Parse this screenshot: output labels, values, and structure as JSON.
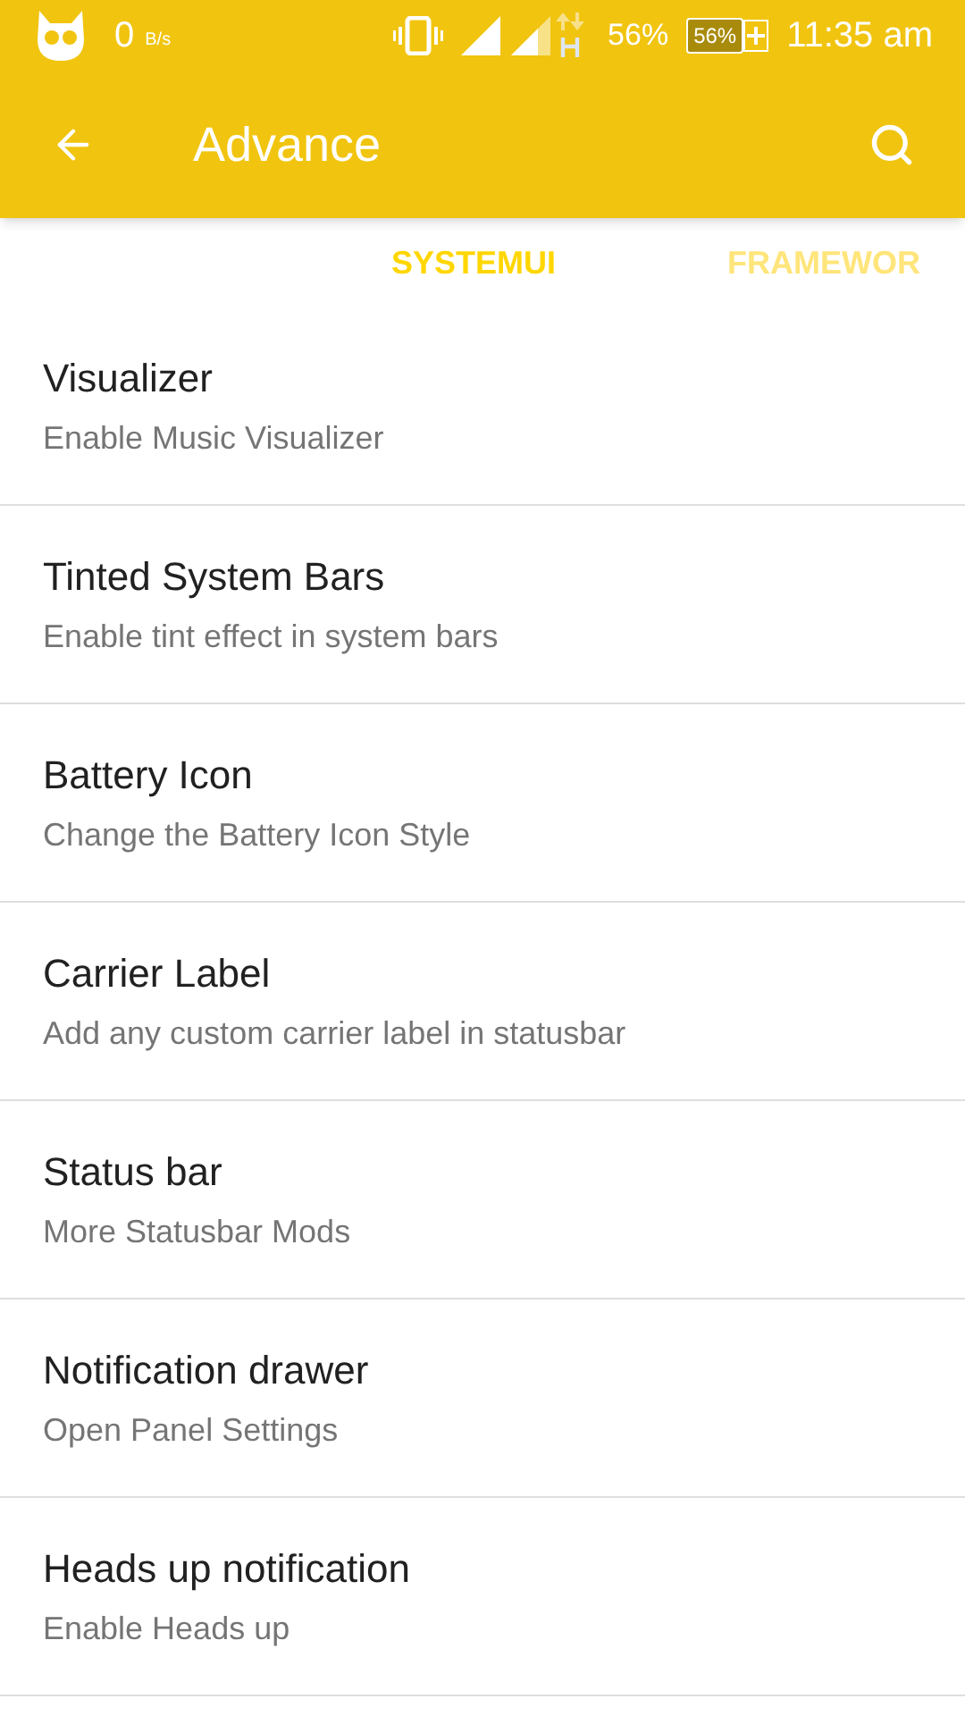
{
  "status_bar": {
    "speed": "0",
    "speed_unit": "B/s",
    "battery_percent": "56%",
    "battery_level": "56%",
    "time": "11:35 am"
  },
  "toolbar": {
    "title": "Advance"
  },
  "tabs": [
    {
      "label": "SYSTEMUI",
      "selected": true
    },
    {
      "label": "FRAMEWOR",
      "selected": false
    }
  ],
  "items": [
    {
      "title": "Visualizer",
      "subtitle": "Enable Music Visualizer"
    },
    {
      "title": "Tinted System Bars",
      "subtitle": "Enable tint effect in system bars"
    },
    {
      "title": "Battery Icon",
      "subtitle": "Change the Battery Icon Style"
    },
    {
      "title": "Carrier Label",
      "subtitle": "Add any custom carrier label in statusbar"
    },
    {
      "title": "Status bar",
      "subtitle": "More Statusbar Mods"
    },
    {
      "title": "Notification drawer",
      "subtitle": "Open Panel Settings"
    },
    {
      "title": "Heads up notification",
      "subtitle": "Enable Heads up"
    }
  ]
}
